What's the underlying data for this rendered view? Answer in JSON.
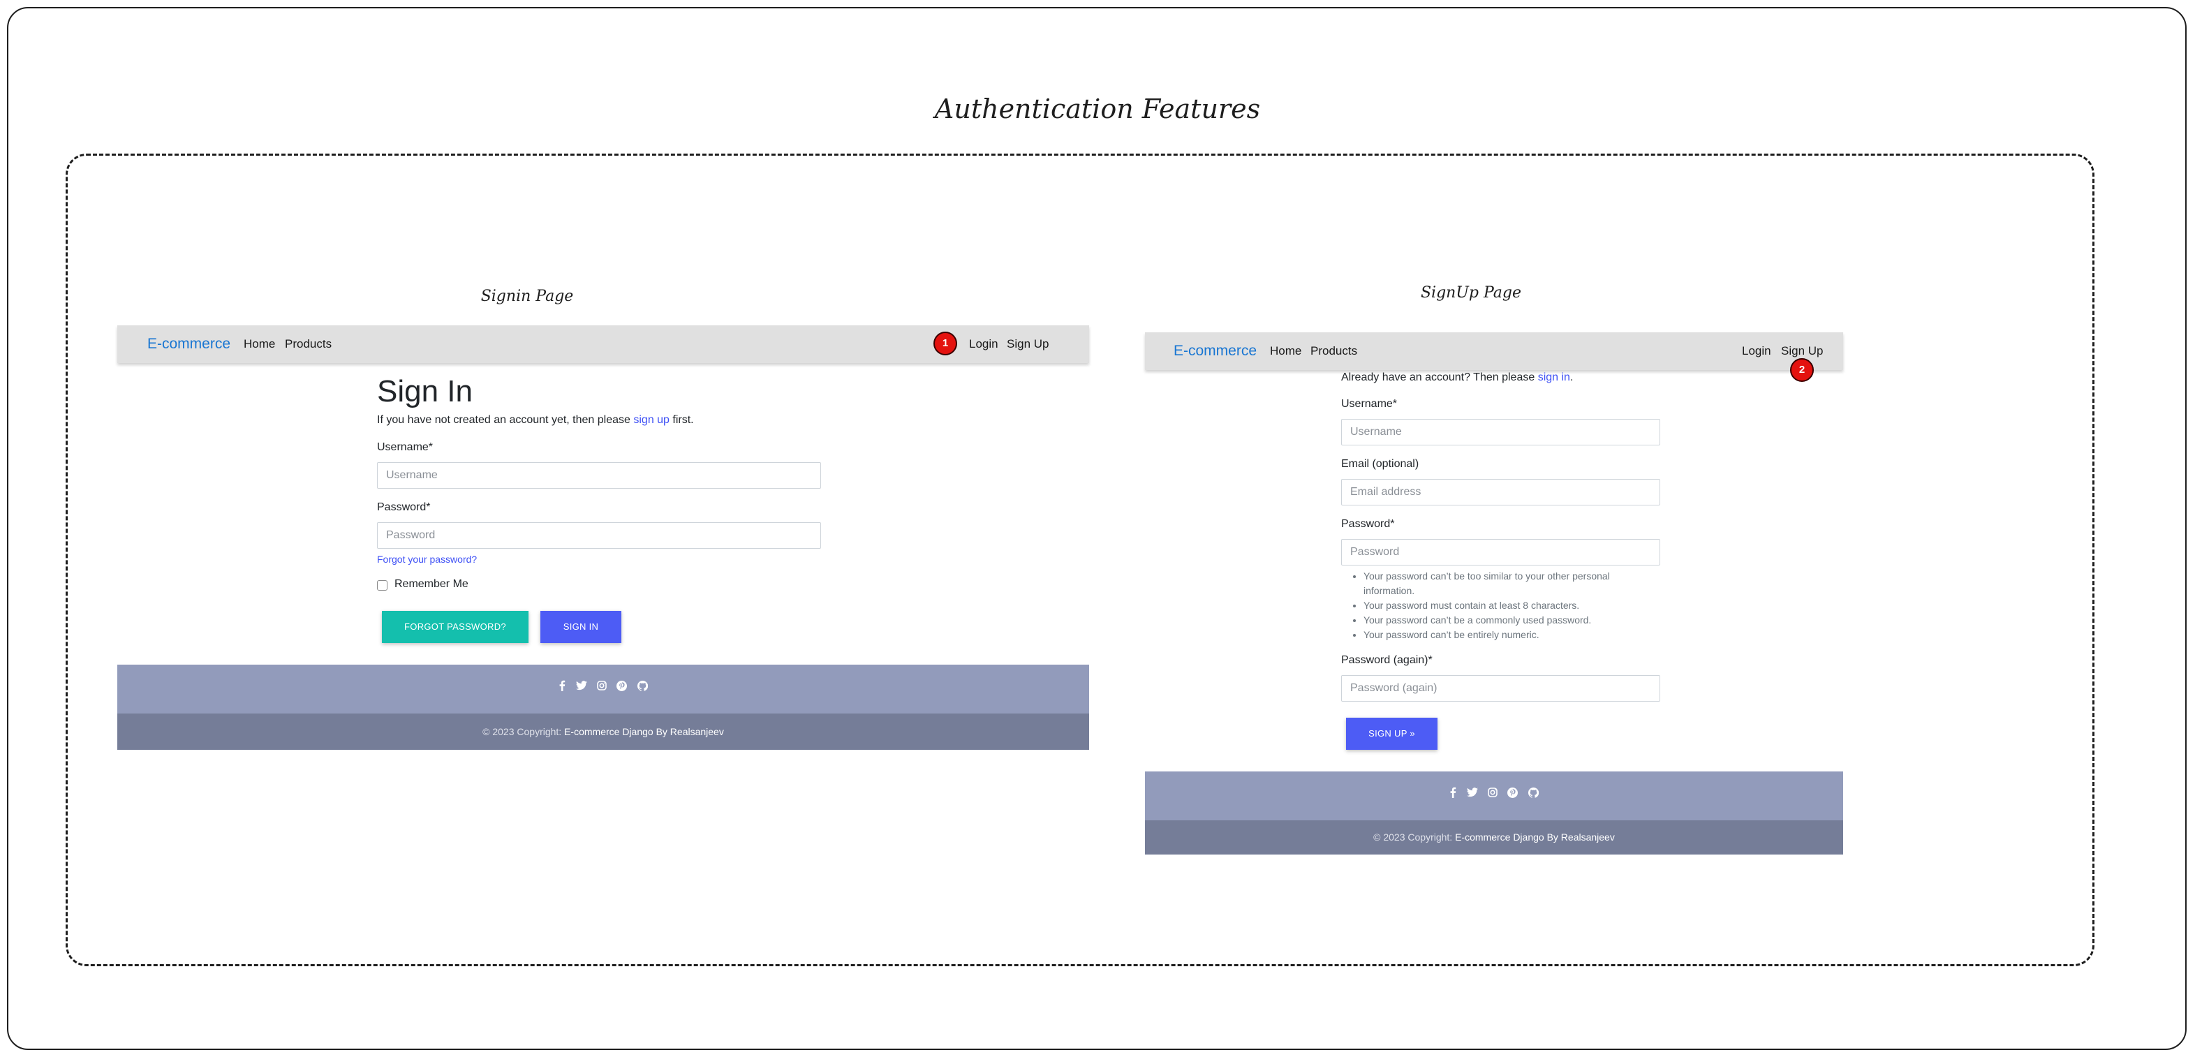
{
  "title": "Authentication Features",
  "signin": {
    "caption": "Signin Page",
    "brand": "E-commerce",
    "nav": {
      "home": "Home",
      "products": "Products",
      "login": "Login",
      "signup": "Sign Up"
    },
    "badge": "1",
    "heading": "Sign In",
    "intro_before": "If you have not created an account yet, then please ",
    "intro_link": "sign up",
    "intro_after": " first.",
    "username_label": "Username*",
    "username_placeholder": "Username",
    "password_label": "Password*",
    "password_placeholder": "Password",
    "forgot_link": "Forgot your password?",
    "remember_label": "Remember Me",
    "forgot_button": "FORGOT PASSWORD?",
    "signin_button": "SIGN IN",
    "copyright_prefix": "© 2023 Copyright: ",
    "copyright_name": "E-commerce Django By Realsanjeev"
  },
  "signup": {
    "caption": "SignUp Page",
    "brand": "E-commerce",
    "nav": {
      "home": "Home",
      "products": "Products",
      "login": "Login",
      "signup": "Sign Up"
    },
    "badge": "2",
    "intro_before": "Already have an account? Then please ",
    "intro_link": "sign in",
    "intro_after": ".",
    "username_label": "Username*",
    "username_placeholder": "Username",
    "email_label": "Email (optional)",
    "email_placeholder": "Email address",
    "password_label": "Password*",
    "password_placeholder": "Password",
    "password_hints": [
      "Your password can’t be too similar to your other personal",
      "information.",
      "Your password must contain at least 8 characters.",
      "Your password can’t be a commonly used password.",
      "Your password can’t be entirely numeric."
    ],
    "password2_label": "Password (again)*",
    "password2_placeholder": "Password (again)",
    "signup_button": "SIGN UP »",
    "copyright_prefix": "© 2023 Copyright: ",
    "copyright_name": "E-commerce Django By Realsanjeev"
  },
  "social_icons": [
    "facebook-icon",
    "twitter-icon",
    "instagram-icon",
    "pinterest-icon",
    "github-icon"
  ]
}
